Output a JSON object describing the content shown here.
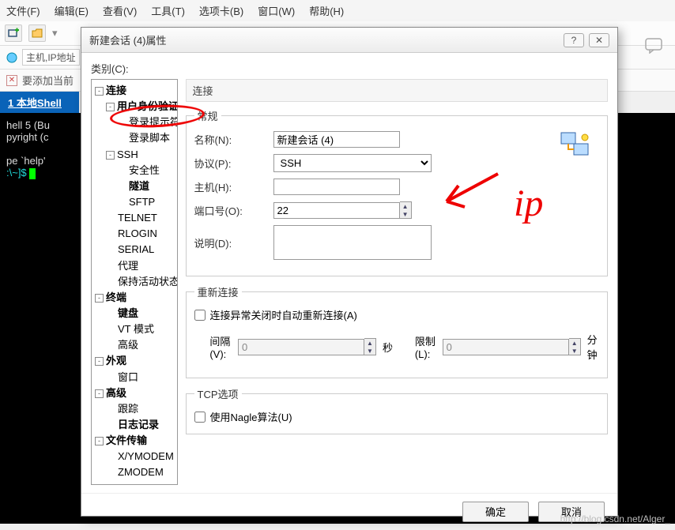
{
  "menu": {
    "file": "文件(F)",
    "edit": "编辑(E)",
    "view": "查看(V)",
    "tools": "工具(T)",
    "tabs": "选项卡(B)",
    "window": "窗口(W)",
    "help": "帮助(H)"
  },
  "address_hint": "主机,IP地址",
  "tip_text": "要添加当前",
  "tab_label": "1 本地Shell",
  "term": {
    "l1": "hell 5 (Bu",
    "l2": "pyright (c",
    "l3": "pe `help'",
    "prompt": ":\\~]$ "
  },
  "dialog": {
    "title": "新建会话 (4)属性",
    "category_label": "类别(C):",
    "section_connect": "连接",
    "group_general": "常规",
    "name_label": "名称(N):",
    "name_value": "新建会话 (4)",
    "proto_label": "协议(P):",
    "proto_value": "SSH",
    "host_label": "主机(H):",
    "host_value": "",
    "port_label": "端口号(O):",
    "port_value": "22",
    "desc_label": "说明(D):",
    "desc_value": "",
    "group_reconnect": "重新连接",
    "reconnect_chk": "连接异常关闭时自动重新连接(A)",
    "interval_label": "间隔(V):",
    "interval_value": "0",
    "interval_unit": "秒",
    "limit_label": "限制(L):",
    "limit_value": "0",
    "limit_unit": "分钟",
    "group_tcp": "TCP选项",
    "nagle_chk": "使用Nagle算法(U)",
    "ok": "确定",
    "cancel": "取消"
  },
  "tree": {
    "connect": "连接",
    "auth": "用户身份验证",
    "prompt": "登录提示符",
    "script": "登录脚本",
    "ssh": "SSH",
    "sec": "安全性",
    "tunnel": "隧道",
    "sftp": "SFTP",
    "telnet": "TELNET",
    "rlogin": "RLOGIN",
    "serial": "SERIAL",
    "proxy": "代理",
    "keep": "保持活动状态",
    "terminal": "终端",
    "kb": "键盘",
    "vt": "VT 模式",
    "adv": "高级",
    "appearance": "外观",
    "win": "窗口",
    "advanced": "高级",
    "trace": "跟踪",
    "log": "日志记录",
    "ft": "文件传输",
    "xy": "X/YMODEM",
    "zm": "ZMODEM"
  },
  "annot": {
    "ip": "ip"
  },
  "watermark": "http://blog.csdn.net/Alger_"
}
